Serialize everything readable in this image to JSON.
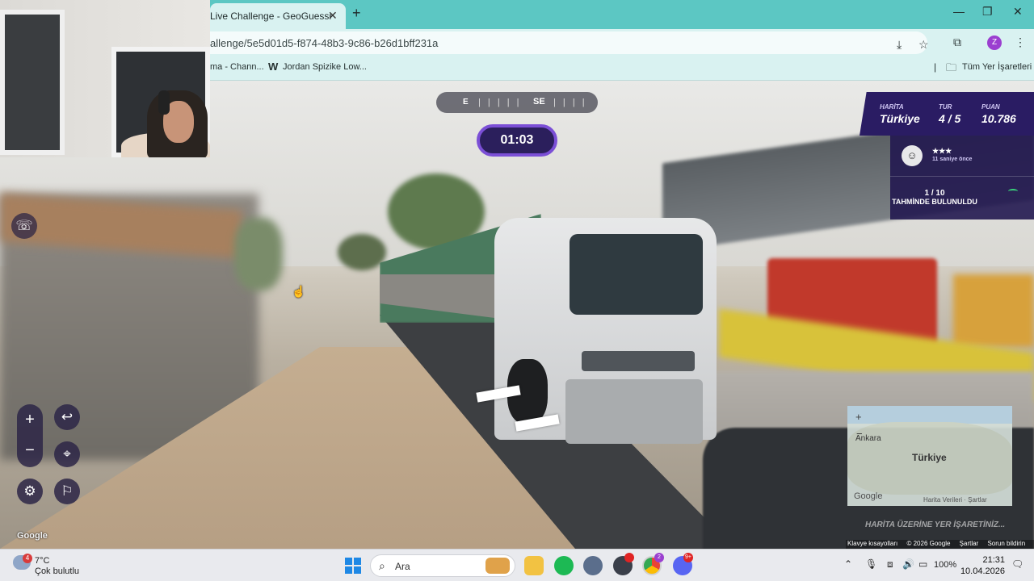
{
  "browser": {
    "tab_title": "Live Challenge - GeoGuessr",
    "tab_close": "✕",
    "new_tab": "+",
    "url": "allenge/5e5d01d5-f874-48b3-9c86-b26d1bff231a",
    "bookmarks": [
      {
        "label": "ma - Chann..."
      },
      {
        "label": "Jordan Spizike Low..."
      }
    ],
    "bookmark_w_glyph": "W",
    "all_bookmarks": "Tüm Yer İşaretleri",
    "avatar_letter": "Z",
    "window_controls": {
      "minimize": "—",
      "restore": "❐",
      "close": "✕"
    }
  },
  "game": {
    "compass": {
      "left": "E",
      "right": "SE",
      "ticks": "| | | | |",
      "ticks2": "| | | |"
    },
    "timer": "01:03",
    "hud": {
      "map_label": "HARİTA",
      "map_value": "Türkiye",
      "round_label": "TUR",
      "round_value": "4 / 5",
      "score_label": "PUAN",
      "score_value": "10.786"
    },
    "player": {
      "stars": "★★★",
      "ago": "11 saniye önce"
    },
    "guess_count": "1 / 10",
    "guess_found_label": "TAHMİNDE BULUNULDU",
    "controls": {
      "zoom_in": "+",
      "zoom_out": "−",
      "undo": "↩",
      "checkpoint": "⌖",
      "settings": "⚙",
      "flag": "⚐"
    },
    "street_google": "Google",
    "minimap": {
      "zoom_in": "+",
      "zoom_out": "−",
      "city": "Ankara",
      "country": "Türkiye",
      "google": "Google",
      "attribution": "Harita Verileri · Şartlar"
    },
    "place_hint": "HARİTA ÜZERİNE YER İŞARETİNİZ...",
    "map_footer": [
      "Klavye kısayolları",
      "© 2026 Google",
      "Şartlar",
      "Sorun bildirin"
    ]
  },
  "taskbar": {
    "weather_temp": "7°C",
    "weather_desc": "Çok bulutlu",
    "weather_badge": "4",
    "search_label": "Ara",
    "battery": "100%",
    "time": "21:31",
    "date": "10.04.2026",
    "chrome_badge": "2",
    "discord_badge": "9+"
  },
  "colors": {
    "tab_strip": "#5cc7c3",
    "toolbar": "#d9f2f1",
    "hud_purple": "#2a1c63",
    "timer_border": "#7b4fd6"
  }
}
